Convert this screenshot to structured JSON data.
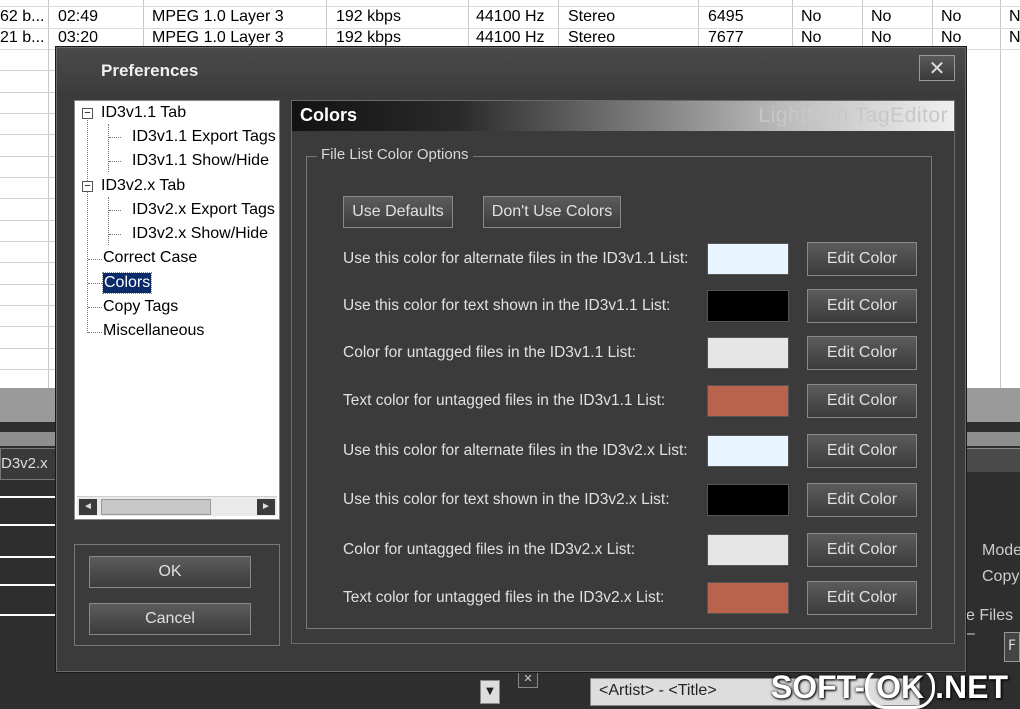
{
  "background": {
    "rows": [
      [
        "62 b...",
        "02:49",
        "MPEG 1.0 Layer 3",
        "192 kbps",
        "44100 Hz",
        "Stereo",
        "6495",
        "No",
        "No",
        "No",
        "N"
      ],
      [
        "21 b...",
        "03:20",
        "MPEG 1.0 Layer 3",
        "192 kbps",
        "44100 Hz",
        "Stereo",
        "7677",
        "No",
        "No",
        "No",
        "N"
      ]
    ],
    "tab_label": "D3v2.x",
    "right_labels": [
      "Mode",
      "Copy",
      "e Files –",
      "F"
    ],
    "format_field": "<Artist> - <Title>",
    "close_x": "✕"
  },
  "dialog": {
    "title": "Preferences",
    "close_glyph": "✕",
    "tree": {
      "items": [
        {
          "label": "ID3v1.1 Tab",
          "toggle": "−"
        },
        {
          "label": "ID3v1.1 Export Tags"
        },
        {
          "label": "ID3v1.1 Show/Hide"
        },
        {
          "label": "ID3v2.x Tab",
          "toggle": "−"
        },
        {
          "label": "ID3v2.x Export Tags"
        },
        {
          "label": "ID3v2.x Show/Hide"
        },
        {
          "label": "Correct Case"
        },
        {
          "label": "Colors"
        },
        {
          "label": "Copy Tags"
        },
        {
          "label": "Miscellaneous"
        }
      ],
      "scroll_left": "◄",
      "scroll_right": "►"
    },
    "ok_label": "OK",
    "cancel_label": "Cancel",
    "panel": {
      "title": "Colors",
      "brand": "LightMan TagEditor",
      "group_title": "File List Color Options",
      "use_defaults_label": "Use Defaults",
      "dont_use_colors_label": "Don't Use Colors",
      "edit_label": "Edit Color",
      "options": [
        {
          "label": "Use this color for alternate files in the ID3v1.1 List:",
          "color": "#e8f4ff"
        },
        {
          "label": "Use this color for text shown in the ID3v1.1 List:",
          "color": "#000000"
        },
        {
          "label": "Color for untagged files in the ID3v1.1 List:",
          "color": "#e6e6e6"
        },
        {
          "label": "Text color for untagged files in the ID3v1.1 List:",
          "color": "#b9624c"
        },
        {
          "label": "Use this color for alternate files in the ID3v2.x List:",
          "color": "#e8f4ff"
        },
        {
          "label": "Use this color for text shown in the ID3v2.x List:",
          "color": "#000000"
        },
        {
          "label": "Color for untagged files in the ID3v2.x List:",
          "color": "#e6e6e6"
        },
        {
          "label": "Text color for untagged files in the ID3v2.x List:",
          "color": "#b9624c"
        }
      ]
    }
  },
  "watermark": {
    "left": "SOFT-",
    "ok": "OK",
    "right": ".NET"
  }
}
